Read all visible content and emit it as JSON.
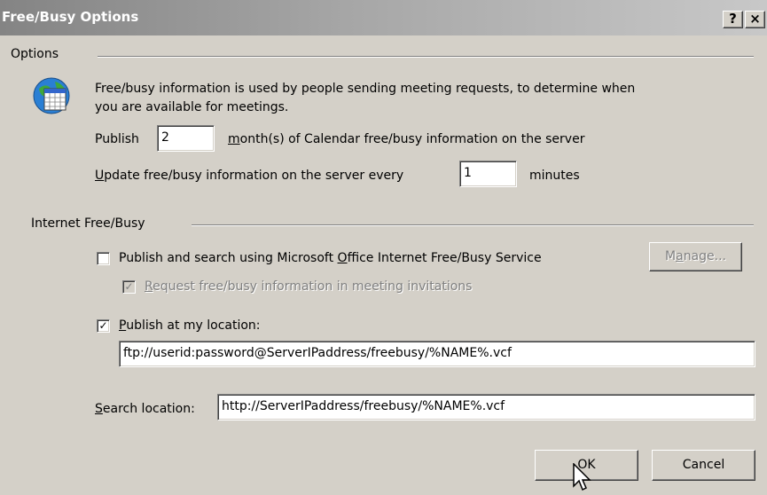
{
  "window": {
    "title": "Free/Busy Options",
    "help_glyph": "?",
    "close_glyph": "×"
  },
  "options": {
    "section_label": "Options",
    "icon": "calendar-icon",
    "description_line1": "Free/busy information is used by people sending meeting requests, to determine when",
    "description_line2": "you are available for meetings.",
    "publish_label": "Publish",
    "publish_months_value": "2",
    "publish_suffix_mnemonic": "m",
    "publish_suffix_rest": "onth(s) of Calendar free/busy information on the server",
    "update_label_mnemonic": "U",
    "update_label_rest": "pdate free/busy information on the server every",
    "update_minutes_value": "1",
    "update_suffix": "minutes"
  },
  "internet": {
    "section_label": "Internet Free/Busy",
    "publish_search_label_pre": "Publish and search using Microsoft ",
    "publish_search_label_mnemonic": "O",
    "publish_search_label_post": "ffice Internet Free/Busy Service",
    "publish_search_checked": false,
    "manage_label_pre": "M",
    "manage_label_mnemonic": "a",
    "manage_label_post": "nage...",
    "request_label_mnemonic": "R",
    "request_label_rest": "equest free/busy information in meeting invitations",
    "request_checked": true,
    "publish_location_label_mnemonic": "P",
    "publish_location_label_rest": "ublish at my location:",
    "publish_location_checked": true,
    "publish_location_value": "ftp://userid:password@ServerIPaddress/freebusy/%NAME%.vcf",
    "search_label_mnemonic": "S",
    "search_label_rest": "earch location:",
    "search_location_value": "http://ServerIPaddress/freebusy/%NAME%.vcf"
  },
  "buttons": {
    "ok_label": "OK",
    "cancel_label": "Cancel"
  }
}
